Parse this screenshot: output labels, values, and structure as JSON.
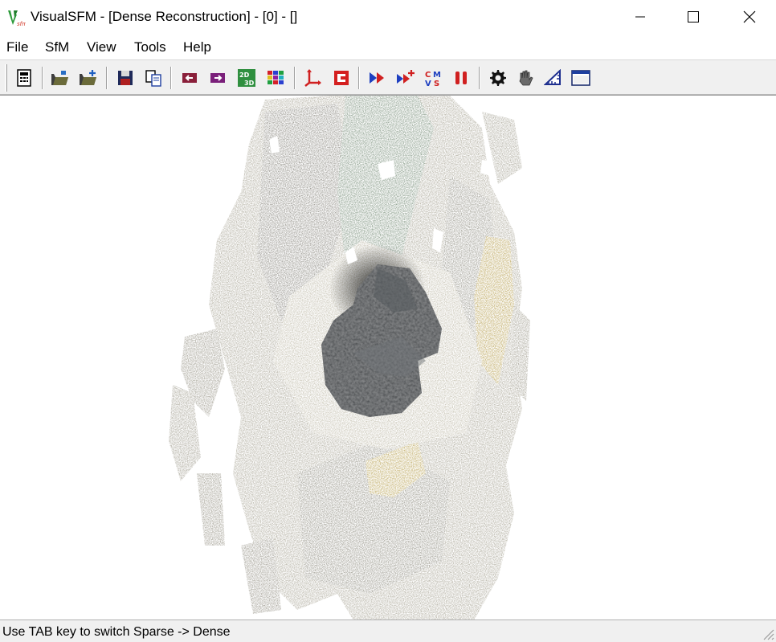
{
  "window": {
    "title": "VisualSFM - [Dense Reconstruction] - [0] - []",
    "icon": "visualsfm-app-icon"
  },
  "menu": {
    "items": [
      {
        "label": "File"
      },
      {
        "label": "SfM"
      },
      {
        "label": "View"
      },
      {
        "label": "Tools"
      },
      {
        "label": "Help"
      }
    ]
  },
  "toolbar": {
    "buttons": [
      {
        "icon": "calculator-icon"
      },
      {
        "icon": "open-folder-icon"
      },
      {
        "icon": "add-images-folder-icon"
      },
      {
        "icon": "save-disk-icon"
      },
      {
        "icon": "copy-icon"
      },
      {
        "icon": "previous-arrow-icon"
      },
      {
        "icon": "next-arrow-icon"
      },
      {
        "icon": "2d-3d-toggle-icon"
      },
      {
        "icon": "color-grid-icon"
      },
      {
        "icon": "axes-icon"
      },
      {
        "icon": "red-box-icon"
      },
      {
        "icon": "compute-missing-match-icon"
      },
      {
        "icon": "compute-3d-reconstruction-icon"
      },
      {
        "icon": "cmvs-icon"
      },
      {
        "icon": "pause-icon"
      },
      {
        "icon": "gear-icon"
      },
      {
        "icon": "hand-icon"
      },
      {
        "icon": "ruler-icon"
      },
      {
        "icon": "window-icon"
      }
    ]
  },
  "viewport": {
    "mode": "Dense Reconstruction",
    "background": "#ffffff",
    "colors": {
      "ground": "#b4b1a4",
      "ground_dark": "#8f8d85",
      "rock": "#3a3c3e",
      "vegetation": "#8fa38f",
      "yellow": "#c0ae6e"
    }
  },
  "status": {
    "text": "Use TAB key to switch Sparse -> Dense"
  }
}
